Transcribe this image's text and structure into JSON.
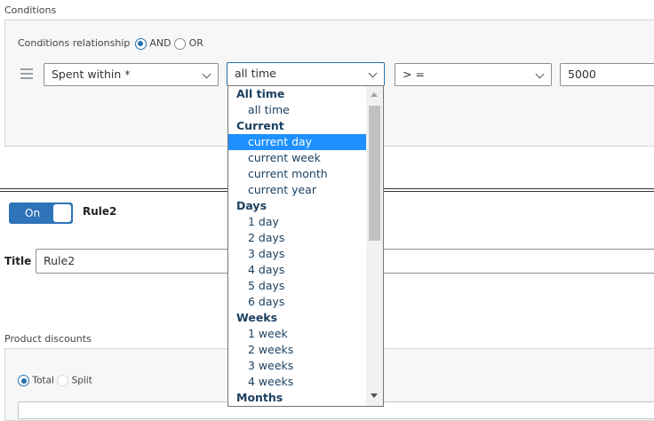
{
  "conditions": {
    "section_label": "Conditions",
    "relationship_label": "Conditions relationship",
    "and_label": "AND",
    "or_label": "OR",
    "field_select": "Spent within *",
    "period_select": "all time",
    "operator_select": "> =",
    "value_input": "5000"
  },
  "dropdown": {
    "items": [
      {
        "type": "group",
        "label": "All time"
      },
      {
        "type": "option",
        "label": "all time"
      },
      {
        "type": "group",
        "label": "Current"
      },
      {
        "type": "option",
        "label": "current day",
        "selected": true
      },
      {
        "type": "option",
        "label": "current week"
      },
      {
        "type": "option",
        "label": "current month"
      },
      {
        "type": "option",
        "label": "current year"
      },
      {
        "type": "group",
        "label": "Days"
      },
      {
        "type": "option",
        "label": "1 day"
      },
      {
        "type": "option",
        "label": "2 days"
      },
      {
        "type": "option",
        "label": "3 days"
      },
      {
        "type": "option",
        "label": "4 days"
      },
      {
        "type": "option",
        "label": "5 days"
      },
      {
        "type": "option",
        "label": "6 days"
      },
      {
        "type": "group",
        "label": "Weeks"
      },
      {
        "type": "option",
        "label": "1 week"
      },
      {
        "type": "option",
        "label": "2 weeks"
      },
      {
        "type": "option",
        "label": "3 weeks"
      },
      {
        "type": "option",
        "label": "4 weeks"
      },
      {
        "type": "group",
        "label": "Months"
      }
    ]
  },
  "rule": {
    "toggle_label": "On",
    "name": "Rule2",
    "title_label": "Title",
    "title_value": "Rule2"
  },
  "product_discounts": {
    "section_label": "Product discounts",
    "total_label": "Total",
    "split_label": "Split"
  },
  "colors": {
    "accent": "#2271b1",
    "selected_option": "#1e90ff",
    "group_text": "#1c3f5e"
  }
}
